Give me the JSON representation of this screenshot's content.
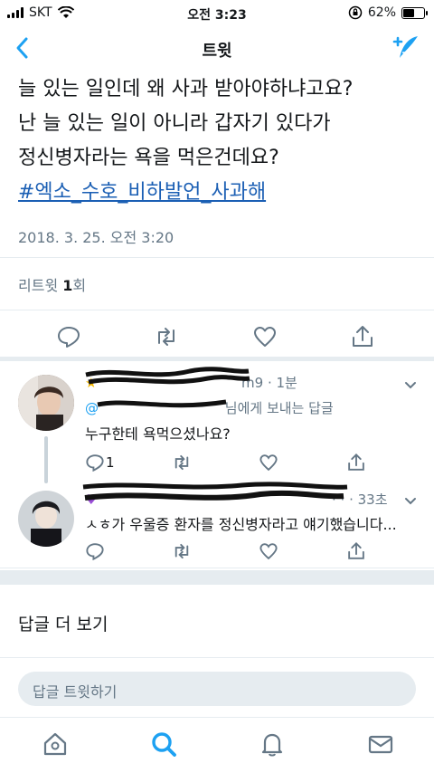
{
  "status_bar": {
    "carrier": "SKT",
    "time": "오전 3:23",
    "battery": "62%",
    "battery_level": 0.62
  },
  "nav": {
    "title": "트윗",
    "back_icon": "chevron-left-icon",
    "compose_icon": "compose-feather-icon"
  },
  "tweet": {
    "lines": [
      "늘 있는 일인데 왜 사과 받아야하냐고요?",
      "난 늘 있는 일이 아니라 갑자기 있다가",
      "정신병자라는 욕을 먹은건데요?"
    ],
    "hashtag": "#엑소_수호_비하발언_사과해",
    "timestamp": "2018. 3. 25. 오전 3:20",
    "retweets_label": "리트윗",
    "retweets_count": "1",
    "retweets_suffix": "회"
  },
  "replies": [
    {
      "time": "1분",
      "handle_suffix": "m9 · 1분",
      "to_text": "님에게 보내는 답글",
      "text": "누구한테 욕먹으셨나요?",
      "reply_count": "1"
    },
    {
      "time": "33초",
      "handle_suffix": "· · · 33초",
      "text": "ㅅㅎ가 우울증 환자를 정신병자라고 얘기했습니다..."
    }
  ],
  "more_replies": "답글 더 보기",
  "reply_placeholder": "답글 트윗하기",
  "tabs": [
    "home-icon",
    "search-icon",
    "notifications-bell-icon",
    "messages-mail-icon"
  ],
  "colors": {
    "link": "#1b5fb4",
    "accent": "#1da1f2",
    "muted": "#657786",
    "divider": "#e6ecf0"
  }
}
